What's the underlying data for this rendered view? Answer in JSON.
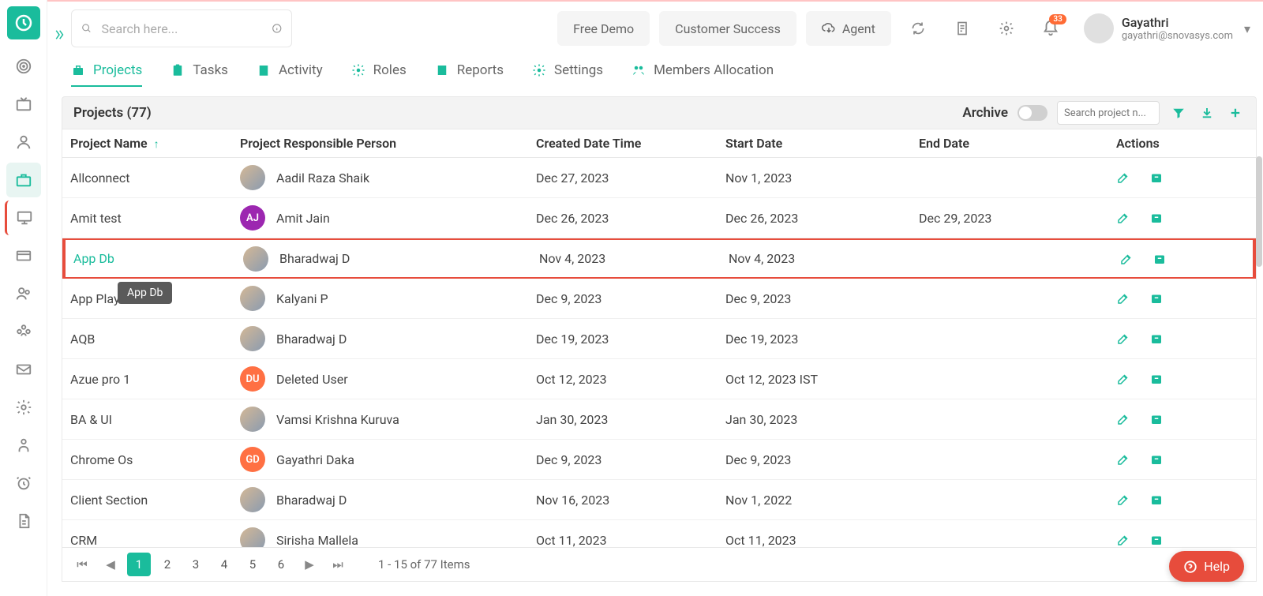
{
  "header": {
    "search_placeholder": "Search here...",
    "free_demo": "Free Demo",
    "customer_success": "Customer Success",
    "agent": "Agent",
    "notif_count": "33",
    "user_name": "Gayathri",
    "user_email": "gayathri@snovasys.com"
  },
  "tabs": [
    "Projects",
    "Tasks",
    "Activity",
    "Roles",
    "Reports",
    "Settings",
    "Members Allocation"
  ],
  "panel": {
    "title": "Projects (77)",
    "archive_label": "Archive",
    "search_placeholder": "Search project n..."
  },
  "columns": {
    "name": "Project Name",
    "person": "Project Responsible Person",
    "created": "Created Date Time",
    "start": "Start Date",
    "end": "End Date",
    "actions": "Actions"
  },
  "rows": [
    {
      "name": "Allconnect",
      "person": "Aadil Raza Shaik",
      "av": "img",
      "init": "",
      "created": "Dec 27, 2023",
      "start": "Nov 1, 2023",
      "end": ""
    },
    {
      "name": "Amit test",
      "person": "Amit Jain",
      "av": "pink",
      "init": "AJ",
      "created": "Dec 26, 2023",
      "start": "Dec 26, 2023",
      "end": "Dec 29, 2023"
    },
    {
      "name": "App Db",
      "person": "Bharadwaj D",
      "av": "img",
      "init": "",
      "created": "Nov 4, 2023",
      "start": "Nov 4, 2023",
      "end": "",
      "highlight": true
    },
    {
      "name": "App Player",
      "person": "Kalyani P",
      "av": "img",
      "init": "",
      "created": "Dec 9, 2023",
      "start": "Dec 9, 2023",
      "end": ""
    },
    {
      "name": "AQB",
      "person": "Bharadwaj D",
      "av": "img",
      "init": "",
      "created": "Dec 19, 2023",
      "start": "Dec 19, 2023",
      "end": ""
    },
    {
      "name": "Azue pro 1",
      "person": "Deleted User",
      "av": "orange",
      "init": "DU",
      "created": "Oct 12, 2023",
      "start": "Oct 12, 2023 IST",
      "end": ""
    },
    {
      "name": "BA & UI",
      "person": "Vamsi Krishna Kuruva",
      "av": "img",
      "init": "",
      "created": "Jan 30, 2023",
      "start": "Jan 30, 2023",
      "end": ""
    },
    {
      "name": "Chrome Os",
      "person": "Gayathri Daka",
      "av": "orange",
      "init": "GD",
      "created": "Dec 9, 2023",
      "start": "Dec 9, 2023",
      "end": ""
    },
    {
      "name": "Client Section",
      "person": "Bharadwaj D",
      "av": "img",
      "init": "",
      "created": "Nov 16, 2023",
      "start": "Nov 1, 2022",
      "end": ""
    },
    {
      "name": "CRM",
      "person": "Sirisha Mallela",
      "av": "img",
      "init": "",
      "created": "Oct 11, 2023",
      "start": "Oct 11, 2023",
      "end": ""
    }
  ],
  "tooltip": "App Db",
  "pagination": {
    "pages": [
      "1",
      "2",
      "3",
      "4",
      "5",
      "6"
    ],
    "info": "1 - 15 of 77 Items"
  },
  "help": "Help"
}
